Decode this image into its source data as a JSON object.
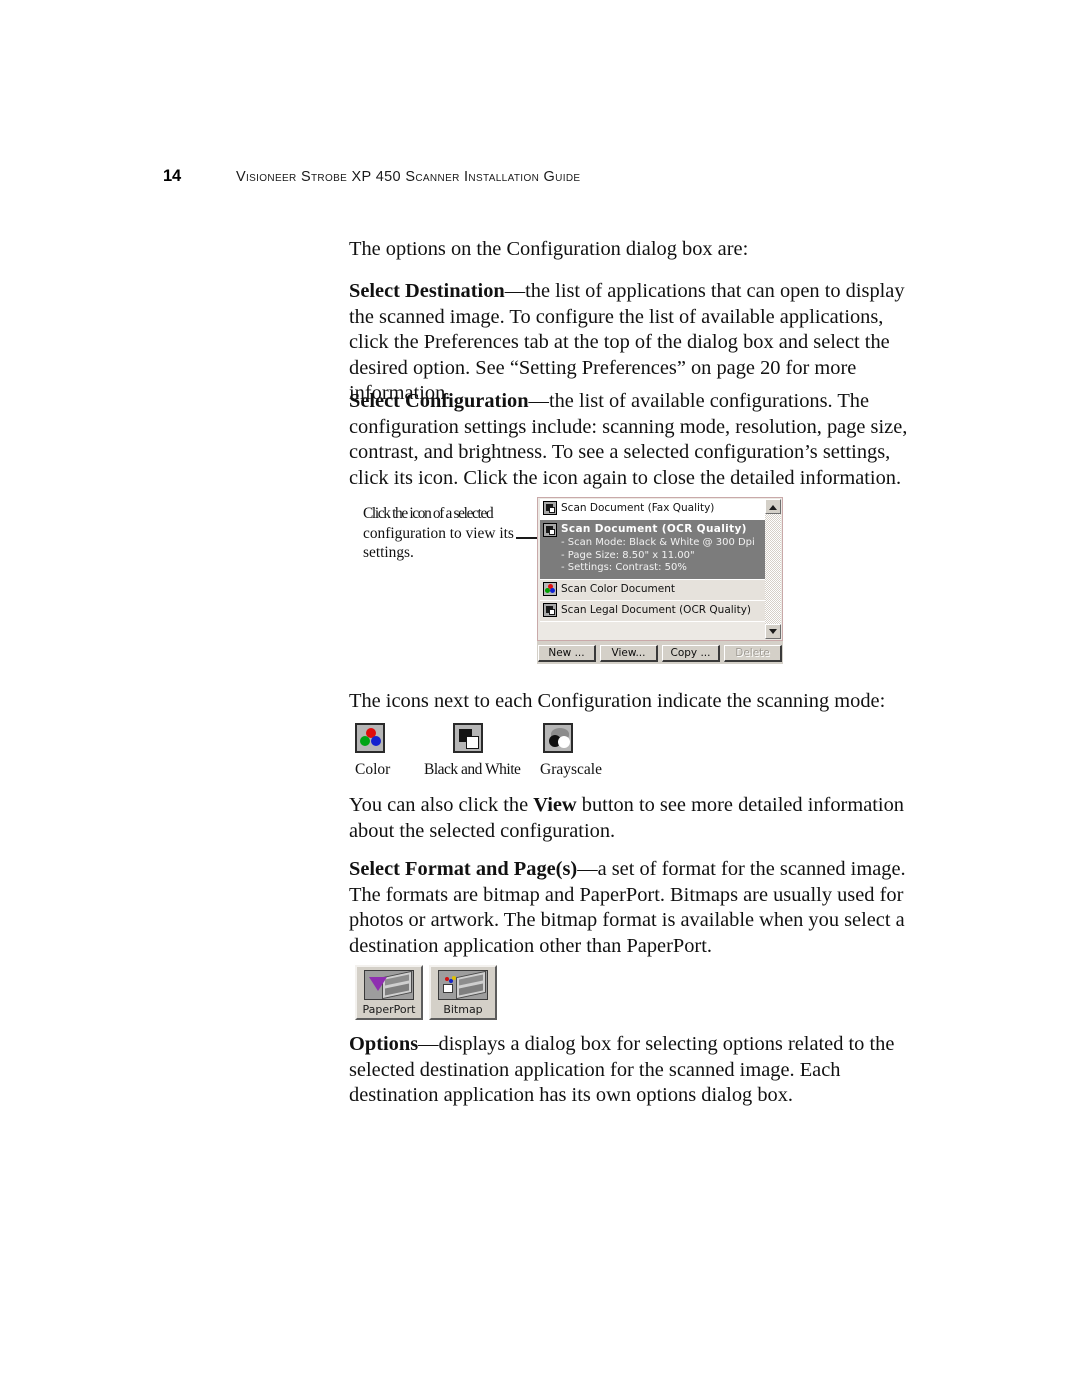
{
  "header": {
    "folio": "14",
    "title": "Visioneer Strobe XP 450 Scanner Installation Guide"
  },
  "paragraphs": {
    "intro": "The options on the Configuration dialog box are:",
    "select_destination": {
      "term": "Select Destination",
      "dash": "—",
      "text": "the list of applications that can open to display the scanned image. To configure the list of available applications, click the Preferences tab at the top of the dialog box and select the desired option. See “Setting Preferences” on page 20 for more information."
    },
    "select_configuration": {
      "term": "Select Configuration",
      "dash": "—",
      "text": "the list of available configurations. The configuration settings include: scanning mode, resolution, page size, contrast, and brightness. To see a selected configuration’s settings, click its icon. Click the icon again to close the detailed information."
    },
    "icons_intro": "The icons next to each Configuration indicate the scanning mode:",
    "view_button": {
      "lead": "You can also click the ",
      "term": "View",
      "text": " button to see more detailed information about the selected configuration."
    },
    "select_format": {
      "term": "Select Format and Page(s)",
      "dash": "—",
      "text": "a set of format for the scanned image. The formats are bitmap and PaperPort. Bitmaps are usually used for photos or artwork. The bitmap format is available when you select a destination application other than PaperPort."
    },
    "options": {
      "term": "Options",
      "dash": "—",
      "text": "displays a dialog box for selecting options related to the selected destination application for the scanned image. Each destination application has its own options dialog box."
    }
  },
  "figure_config": {
    "caption_line1": "Click the icon of a selected",
    "caption_line2": "configuration to view its",
    "caption_line3": "settings.",
    "list_items": [
      {
        "label": "Scan Document (Fax Quality)",
        "icon": "black-white-mode-icon",
        "selected": false
      },
      {
        "label": "Scan Document (OCR Quality)",
        "icon": "black-white-mode-icon",
        "selected": true,
        "details": [
          "- Scan Mode: Black & White @ 300 Dpi",
          "- Page Size:  8.50\" x 11.00\"",
          "- Settings: Contrast: 50%"
        ]
      },
      {
        "label": "Scan Color Document",
        "icon": "color-mode-icon",
        "selected": false
      },
      {
        "label": "Scan Legal Document (OCR Quality)",
        "icon": "black-white-mode-icon",
        "selected": false
      }
    ],
    "buttons": [
      {
        "label": "New ...",
        "enabled": true
      },
      {
        "label": "View...",
        "enabled": true
      },
      {
        "label": "Copy ...",
        "enabled": true
      },
      {
        "label": "Delete",
        "enabled": false
      }
    ]
  },
  "figure_modes": {
    "items": [
      {
        "label": "Color",
        "icon": "color-mode-icon"
      },
      {
        "label": "Black and White",
        "icon": "black-white-mode-icon"
      },
      {
        "label": "Grayscale",
        "icon": "grayscale-mode-icon"
      }
    ]
  },
  "figure_format": {
    "buttons": [
      {
        "label": "PaperPort",
        "icon": "paperport-icon"
      },
      {
        "label": "Bitmap",
        "icon": "bitmap-icon"
      }
    ]
  },
  "colors": {
    "selection_background": "#7c7c7c",
    "dialog_face": "#d4d0c8",
    "list_border": "#c9a9a9",
    "paperport_purple": "#8e2fb0"
  }
}
